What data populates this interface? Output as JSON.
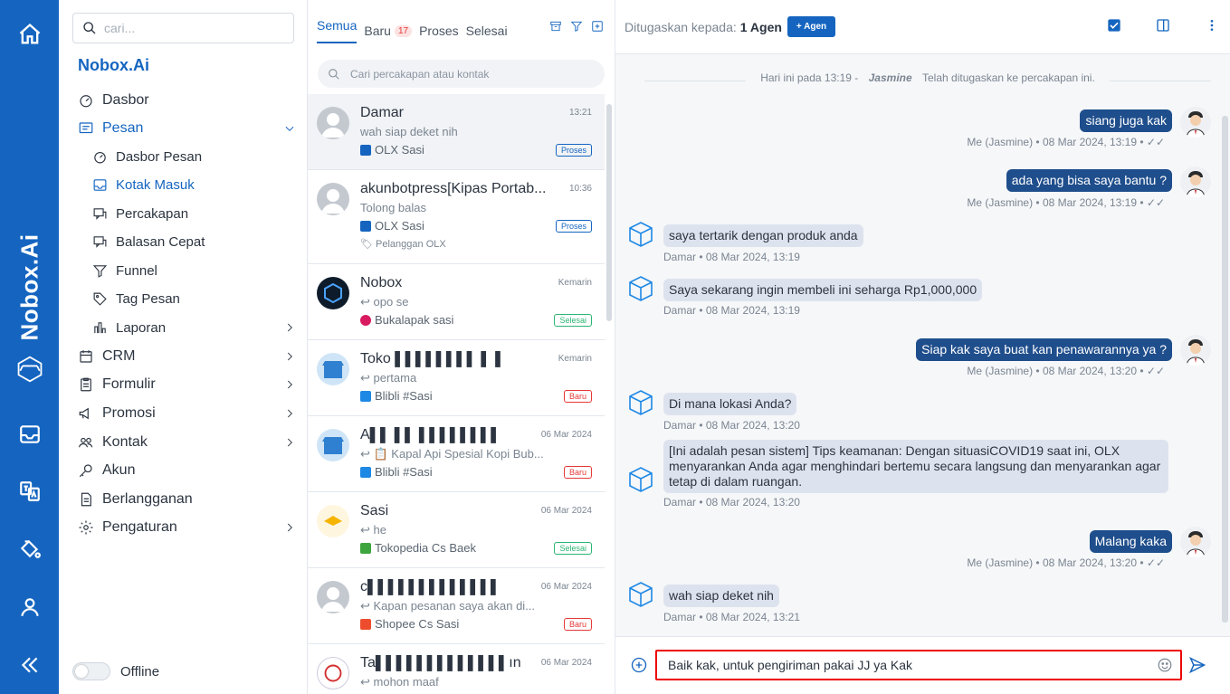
{
  "rail": {
    "brand": "Nobox.Ai",
    "icons": [
      "home-icon",
      "brand-logo-icon",
      "inbox-icon",
      "translate-icon",
      "paint-bucket-icon",
      "user-icon",
      "collapse-icon"
    ]
  },
  "menu": {
    "search_placeholder": "cari...",
    "brand": "Nobox.Ai",
    "items": [
      {
        "label": "Dasbor"
      },
      {
        "label": "Pesan"
      },
      {
        "label": "Dasbor Pesan"
      },
      {
        "label": "Kotak Masuk"
      },
      {
        "label": "Percakapan"
      },
      {
        "label": "Balasan Cepat"
      },
      {
        "label": "Funnel"
      },
      {
        "label": "Tag Pesan"
      },
      {
        "label": "Laporan"
      },
      {
        "label": "CRM"
      },
      {
        "label": "Formulir"
      },
      {
        "label": "Promosi"
      },
      {
        "label": "Kontak"
      },
      {
        "label": "Akun"
      },
      {
        "label": "Berlangganan"
      },
      {
        "label": "Pengaturan"
      }
    ],
    "offline_label": "Offline"
  },
  "list": {
    "tabs": [
      {
        "label": "Semua"
      },
      {
        "label": "Baru",
        "count": "17"
      },
      {
        "label": "Proses"
      },
      {
        "label": "Selesai"
      }
    ],
    "search_placeholder": "Cari percakapan atau kontak",
    "conversations": [
      {
        "name": "Damar",
        "time": "13:21",
        "message": "wah siap deket nih",
        "channel": "OLX Sasi",
        "status": "Proses",
        "tag": ""
      },
      {
        "name": "akunbotpress[Kipas Portab...",
        "time": "10:36",
        "message": "Tolong balas",
        "channel": "OLX Sasi",
        "status": "Proses",
        "tag": "Pelanggan OLX"
      },
      {
        "name": "Nobox",
        "time": "Kemarin",
        "message": "↩ opo se",
        "channel": "Bukalapak sasi",
        "status": "Selesai",
        "tag": ""
      },
      {
        "name": "Toko ▌▌▌▌▌▌▌▌ ▌ ▌",
        "time": "Kemarin",
        "message": "↩ pertama",
        "channel": "Blibli #Sasi",
        "status": "Baru",
        "tag": ""
      },
      {
        "name": "A▌▌ ▌▌ ▌▌▌▌▌▌▌▌",
        "time": "06 Mar 2024",
        "message": "↩ 📋 Kapal Api Spesial Kopi Bub...",
        "channel": "Blibli #Sasi",
        "status": "Baru",
        "tag": ""
      },
      {
        "name": "Sasi",
        "time": "06 Mar 2024",
        "message": "↩ he",
        "channel": "Tokopedia Cs Baek",
        "status": "Selesai",
        "tag": ""
      },
      {
        "name": "c▌▌▌▌▌▌▌▌▌▌▌▌▌",
        "time": "06 Mar 2024",
        "message": "↩ Kapan pesanan saya akan di...",
        "channel": "Shopee Cs Sasi",
        "status": "Baru",
        "tag": ""
      },
      {
        "name": "Ta▌▌▌▌▌▌▌▌▌▌▌▌▌ın",
        "time": "06 Mar 2024",
        "message": "↩ mohon maaf",
        "channel": "",
        "status": "",
        "tag": ""
      }
    ]
  },
  "chat": {
    "assigned_label": "Ditugaskan kepada:",
    "assigned_value": "1 Agen",
    "add_agent": "+ Agen",
    "system_prefix": "Hari ini pada 13:19 -",
    "system_name": "Jasmine",
    "system_suffix": "Telah ditugaskan ke percakapan ini.",
    "messages": [
      {
        "dir": "out",
        "text": "siang juga kak",
        "meta": "Me (Jasmine) • 08 Mar 2024, 13:19 • ✓✓"
      },
      {
        "dir": "out",
        "text": "ada yang bisa saya bantu ?",
        "meta": "Me (Jasmine) • 08 Mar 2024, 13:19 • ✓✓"
      },
      {
        "dir": "in",
        "text": "saya tertarik dengan produk anda",
        "meta": "Damar • 08 Mar 2024, 13:19"
      },
      {
        "dir": "in",
        "text": "Saya sekarang ingin membeli ini seharga Rp1,000,000",
        "meta": "Damar • 08 Mar 2024, 13:19"
      },
      {
        "dir": "out",
        "text": "Siap kak saya buat kan penawarannya ya ?",
        "meta": "Me (Jasmine) • 08 Mar 2024, 13:20 • ✓✓"
      },
      {
        "dir": "in",
        "text": "Di mana lokasi Anda?",
        "meta": "Damar • 08 Mar 2024, 13:20"
      },
      {
        "dir": "in",
        "text": "[Ini adalah pesan sistem] Tips keamanan: Dengan situasiCOVID19 saat ini, OLX menyarankan Anda agar menghindari bertemu secara langsung dan menyarankan agar tetap di dalam ruangan.",
        "meta": "Damar • 08 Mar 2024, 13:20"
      },
      {
        "dir": "out",
        "text": "Malang kaka",
        "meta": "Me (Jasmine) • 08 Mar 2024, 13:20 • ✓✓"
      },
      {
        "dir": "in",
        "text": "wah siap deket nih",
        "meta": "Damar • 08 Mar 2024, 13:21"
      }
    ],
    "composer_value": "Baik kak, untuk pengiriman pakai JJ ya Kak"
  }
}
